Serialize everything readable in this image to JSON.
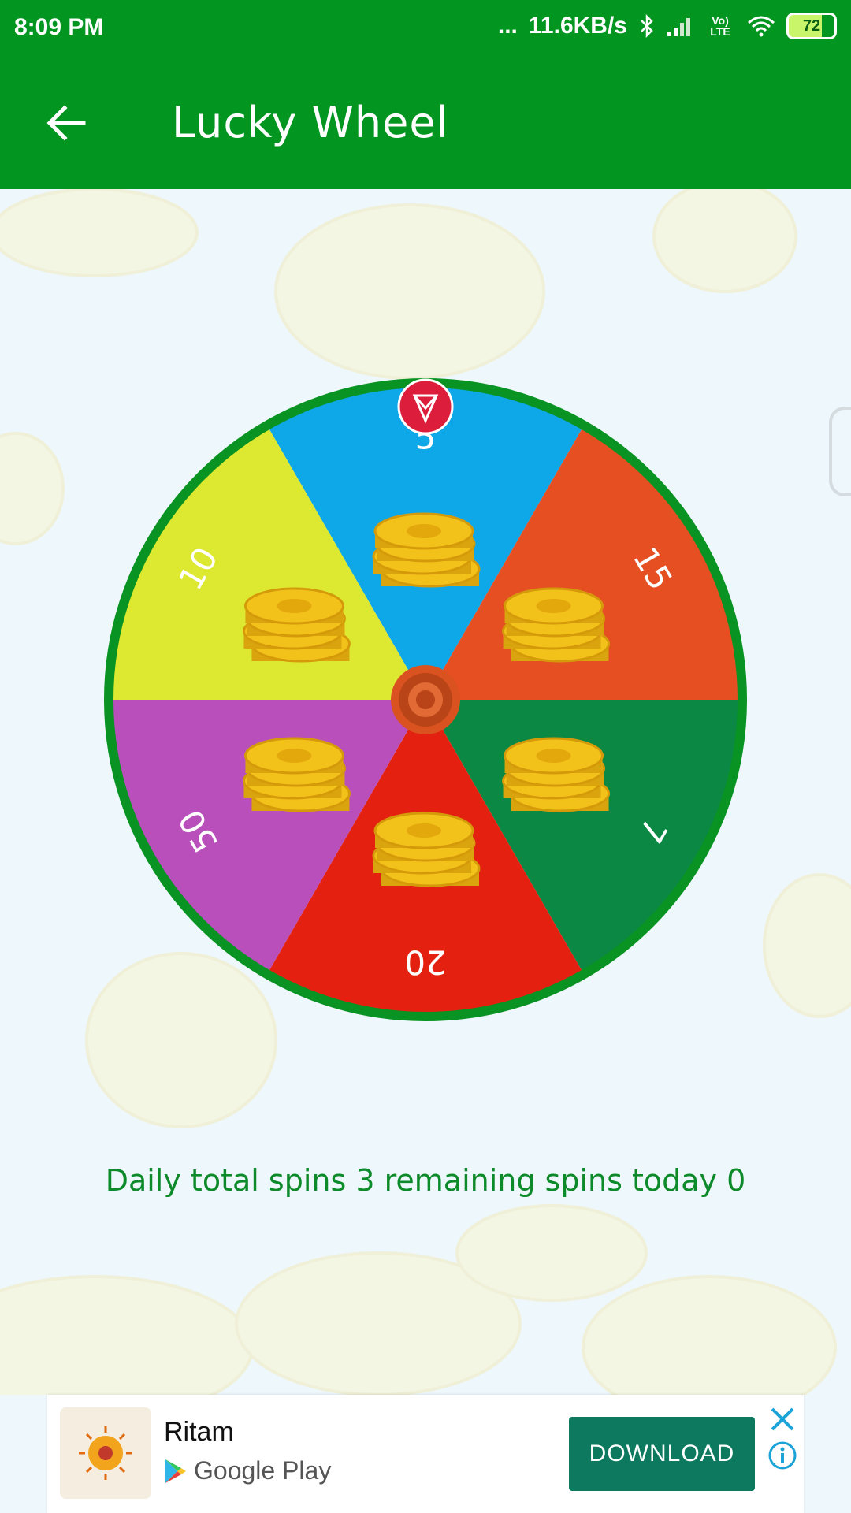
{
  "status_bar": {
    "time": "8:09 PM",
    "dots": "...",
    "network_speed": "11.6KB/s",
    "volte": "Vo) LTE",
    "battery": "72"
  },
  "app_bar": {
    "title": "Lucky Wheel",
    "back_icon": "arrow-left-icon"
  },
  "wheel": {
    "segments": [
      {
        "label": "5",
        "color": "#0ea8e8"
      },
      {
        "label": "15",
        "color": "#e54f22"
      },
      {
        "label": "7",
        "color": "#0b8843"
      },
      {
        "label": "20",
        "color": "#e42110"
      },
      {
        "label": "50",
        "color": "#b94fba"
      },
      {
        "label": "10",
        "color": "#dde830"
      }
    ],
    "rim_color": "#089322",
    "pointer_color": "#dc1d3c"
  },
  "spins": {
    "text": "Daily total spins 3 remaining spins today 0"
  },
  "ad": {
    "app_name": "Ritam",
    "store_name": "Google Play",
    "download_label": "DOWNLOAD",
    "close_icon": "close-icon",
    "info_icon": "info-icon",
    "accent": "#0d7a5f"
  }
}
